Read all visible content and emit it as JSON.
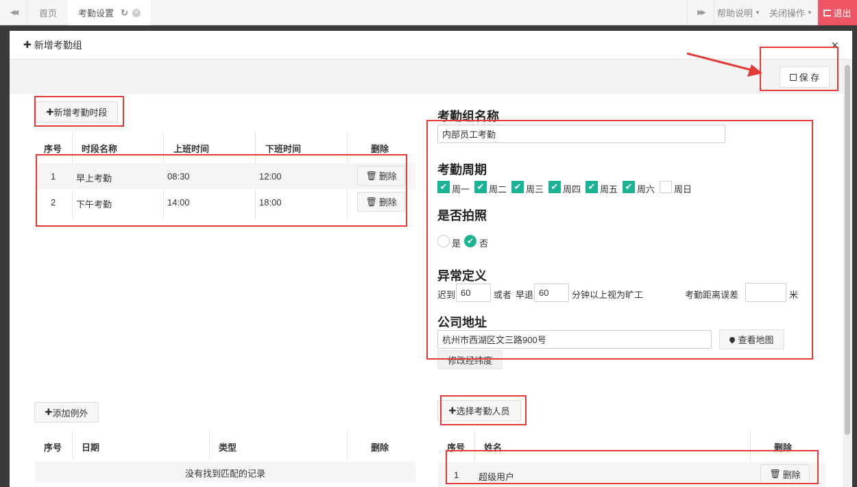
{
  "tabs": {
    "prev_glyph": "◀◀",
    "home": "首页",
    "current": "考勤设置",
    "refresh_glyph": "↻",
    "close_glyph": "×",
    "next_glyph": "▶▶",
    "help": "帮助说明",
    "close_ops": "关闭操作",
    "logout": "退出"
  },
  "modal": {
    "title": "新增考勤组",
    "close_glyph": "×",
    "save": "保 存"
  },
  "periods": {
    "add_button": "新增考勤时段",
    "columns": [
      "序号",
      "时段名称",
      "上班时间",
      "下班时间",
      "删除"
    ],
    "rows": [
      {
        "no": "1",
        "name": "早上考勤",
        "start": "08:30",
        "end": "12:00",
        "delete": "删除"
      },
      {
        "no": "2",
        "name": "下午考勤",
        "start": "14:00",
        "end": "18:00",
        "delete": "删除"
      }
    ]
  },
  "form": {
    "group_name_title": "考勤组名称",
    "group_name_value": "内部员工考勤",
    "cycle_title": "考勤周期",
    "days": [
      {
        "label": "周一",
        "checked": true
      },
      {
        "label": "周二",
        "checked": true
      },
      {
        "label": "周三",
        "checked": true
      },
      {
        "label": "周四",
        "checked": true
      },
      {
        "label": "周五",
        "checked": true
      },
      {
        "label": "周六",
        "checked": true
      },
      {
        "label": "周日",
        "checked": false
      }
    ],
    "photo_title": "是否拍照",
    "photo_yes": "是",
    "photo_no": "否",
    "photo_selected": "否",
    "abnormal_title": "异常定义",
    "late_label": "迟到",
    "late_value": "60",
    "or_label": "或者",
    "early_label": "早退",
    "early_value": "60",
    "absent_label": "分钟以上视为旷工",
    "distance_label": "考勤距离误差",
    "distance_value": "",
    "meter_label": "米",
    "address_title": "公司地址",
    "address_value": "杭州市西湖区文三路900号",
    "view_map": "查看地图",
    "edit_coords": "修改经纬度"
  },
  "exceptions": {
    "add_button": "添加例外",
    "columns": [
      "序号",
      "日期",
      "类型",
      "删除"
    ],
    "empty_text": "没有找到匹配的记录"
  },
  "staff": {
    "add_button": "选择考勤人员",
    "columns": [
      "序号",
      "姓名",
      "删除"
    ],
    "rows": [
      {
        "no": "1",
        "name": "超级用户",
        "delete": "删除"
      }
    ]
  },
  "colors": {
    "accent": "#1ab394",
    "logout": "#ed5565",
    "annotation": "#e53935"
  }
}
